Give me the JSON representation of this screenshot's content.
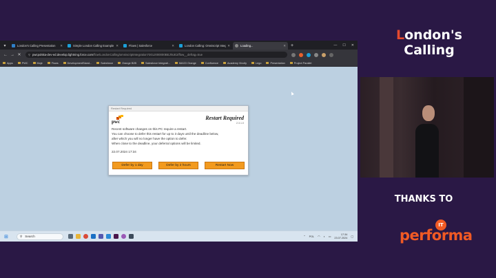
{
  "browser": {
    "tabs": [
      {
        "label": "London's Calling Presentation",
        "color": "#2f80c8"
      },
      {
        "label": "Simple London Calling Example",
        "color": "#1ba0d8"
      },
      {
        "label": "Flows | Salesforce",
        "color": "#1ba0d8"
      },
      {
        "label": "London Calling: Omniscript Integ",
        "color": "#1ba0d8"
      },
      {
        "label": "Loading...",
        "color": "#888888"
      }
    ],
    "url_host": "pwcpolska-dev-ed.develop.lightning.force.com",
    "url_path": "/flow/LondonCalling/omniscriptIntegration?301J000000BEJhUE2/flow__defrag=true",
    "bookmarks": [
      "Apps",
      "PWC",
      "Moje",
      "Flows",
      "DevelopmentStand...",
      "Salesforce",
      "Orange B2B",
      "Salesforce Integrati...",
      "MACD Orange",
      "Confluence",
      "Academy Vincity",
      "Lego",
      "Presentation",
      "Project Parallel"
    ]
  },
  "dialog": {
    "window_title": "Restart Required",
    "logo_text": "pwc",
    "heading": "Restart Required",
    "version": "2.3.1.0",
    "body_lines": [
      "Recent software changes on this PC require a restart.",
      "You can choose to defer this restart for up to 3 days until the deadline below,",
      "after which you will no longer have the option to defer.",
      "When close to the deadline, your deferral options will be limited."
    ],
    "deadline": "22.07.2024 17:34",
    "buttons": {
      "defer_day": "Defer by 1 day",
      "defer_hours": "Defer by 2 hours",
      "restart_now": "Restart Now"
    }
  },
  "taskbar": {
    "search_placeholder": "Search",
    "language": "POL",
    "time": "17:34",
    "date": "23.07.2024"
  },
  "event": {
    "title_line1": "ondon's",
    "title_l": "L",
    "title_line2": "Calling",
    "thanks": "THANKS TO",
    "sponsor": "performa",
    "sponsor_badge": "IT"
  },
  "colors": {
    "background": "#2a1845",
    "accent_orange": "#f29a1f",
    "brand_red": "#e64a2e",
    "sponsor_orange": "#f15a24"
  }
}
